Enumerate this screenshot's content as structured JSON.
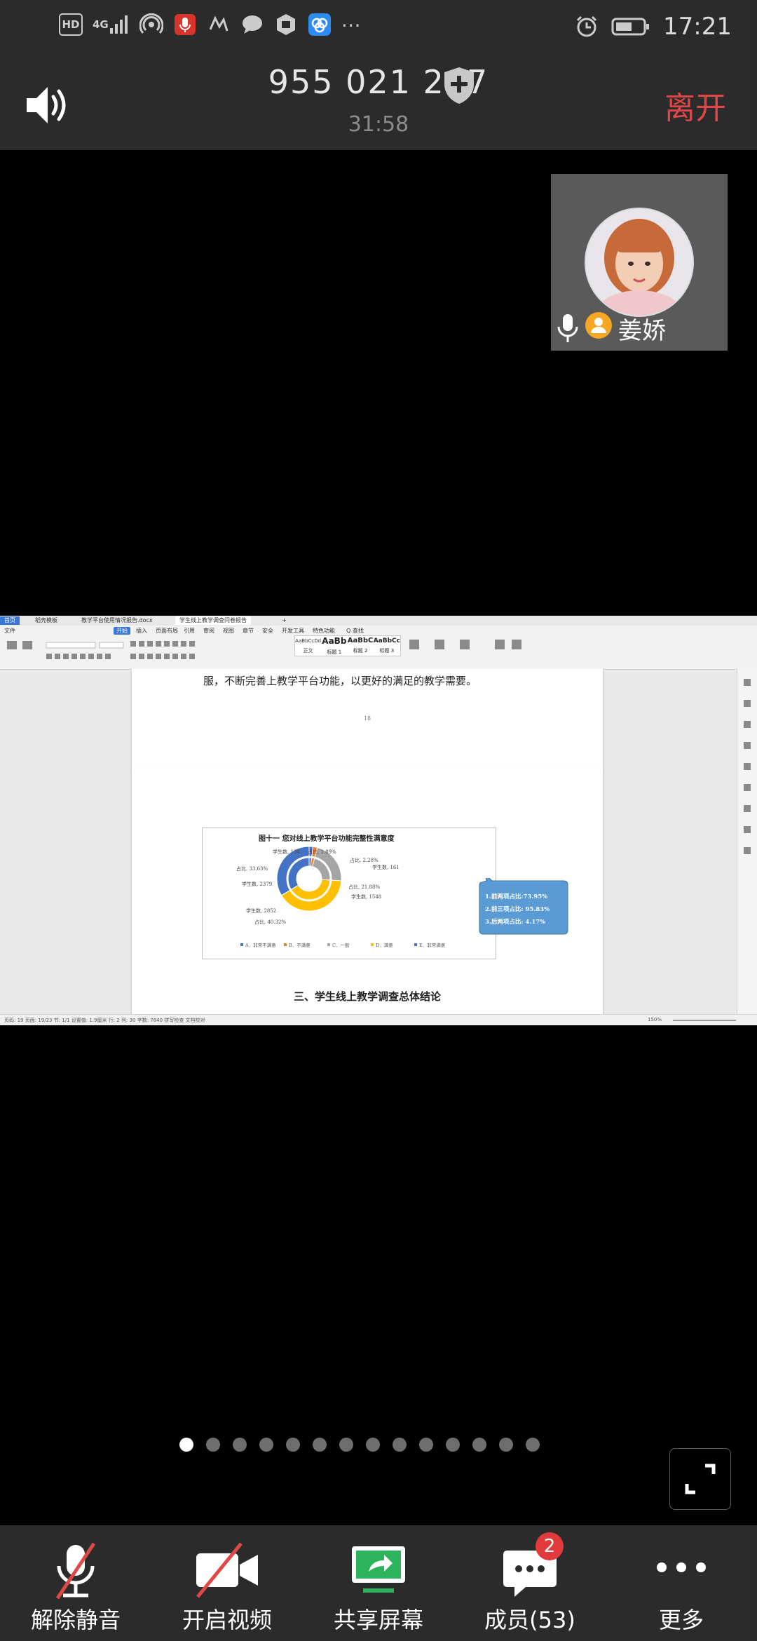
{
  "status_bar": {
    "network": "4G",
    "hd": "HD",
    "time": "17:21"
  },
  "header": {
    "meeting_id": "955 021 267",
    "duration": "31:58",
    "leave_label": "离开"
  },
  "participant": {
    "name": "姜娇"
  },
  "document": {
    "tabs": [
      "首页",
      "稻壳模板",
      "教学平台使用情况报告.docx",
      "学生线上教学调查问卷报告"
    ],
    "menu": [
      "文件",
      "开始",
      "插入",
      "页面布局",
      "引用",
      "审阅",
      "视图",
      "章节",
      "安全",
      "开发工具",
      "特色功能",
      "Q 查找"
    ],
    "style_samples": [
      "AaBbCcDd",
      "AaBb",
      "AaBbC",
      "AaBbCc"
    ],
    "style_names": [
      "正文",
      "标题 1",
      "标题 2",
      "标题 3"
    ],
    "prev_page_text": "服，不断完善上教学平台功能，以更好的满足的教学需要。",
    "prev_page_number": "18",
    "section_heading": "三、学生线上教学调查总体结论",
    "statusline": "页码: 19   页面: 19/23   节: 1/1   设置值: 1.9厘米   行: 2   列: 30   字数: 7840   拼写检查   文档校对",
    "zoom": "150%"
  },
  "chart_data": {
    "type": "pie",
    "title": "图十一 您对线上教学平台功能完整性满意度",
    "categories": [
      "A．非常不满意",
      "B．不满意",
      "C．一般",
      "D．满意",
      "E．非常满意"
    ],
    "series": [
      {
        "name": "学生数",
        "values": [
          134,
          161,
          1548,
          2852,
          2379
        ]
      },
      {
        "name": "占比",
        "values": [
          1.89,
          2.28,
          21.88,
          40.32,
          33.63
        ]
      }
    ],
    "labels": [
      "学生数, 134",
      "占比, 1.89%",
      "占比, 2.28%",
      "学生数, 161",
      "占比, 21.88%",
      "学生数, 1548",
      "学生数, 2852",
      "占比, 40.32%",
      "学生数, 2379",
      "占比, 33.63%"
    ],
    "colors": [
      "#4472c4",
      "#ed7d31",
      "#a5a5a5",
      "#ffc000",
      "#4472c4"
    ],
    "callout": [
      "1.前两项占比:73.95%",
      "2.前三项占比: 95.83%",
      "3.后两项占比: 4.17%"
    ],
    "legend_placement": "bottom"
  },
  "pager": {
    "dot_count": 14,
    "active_index": 0
  },
  "toolbar": {
    "unmute_label": "解除静音",
    "video_label": "开启视频",
    "share_label": "共享屏幕",
    "members_label": "成员(53)",
    "members_badge": "2",
    "more_label": "更多"
  }
}
